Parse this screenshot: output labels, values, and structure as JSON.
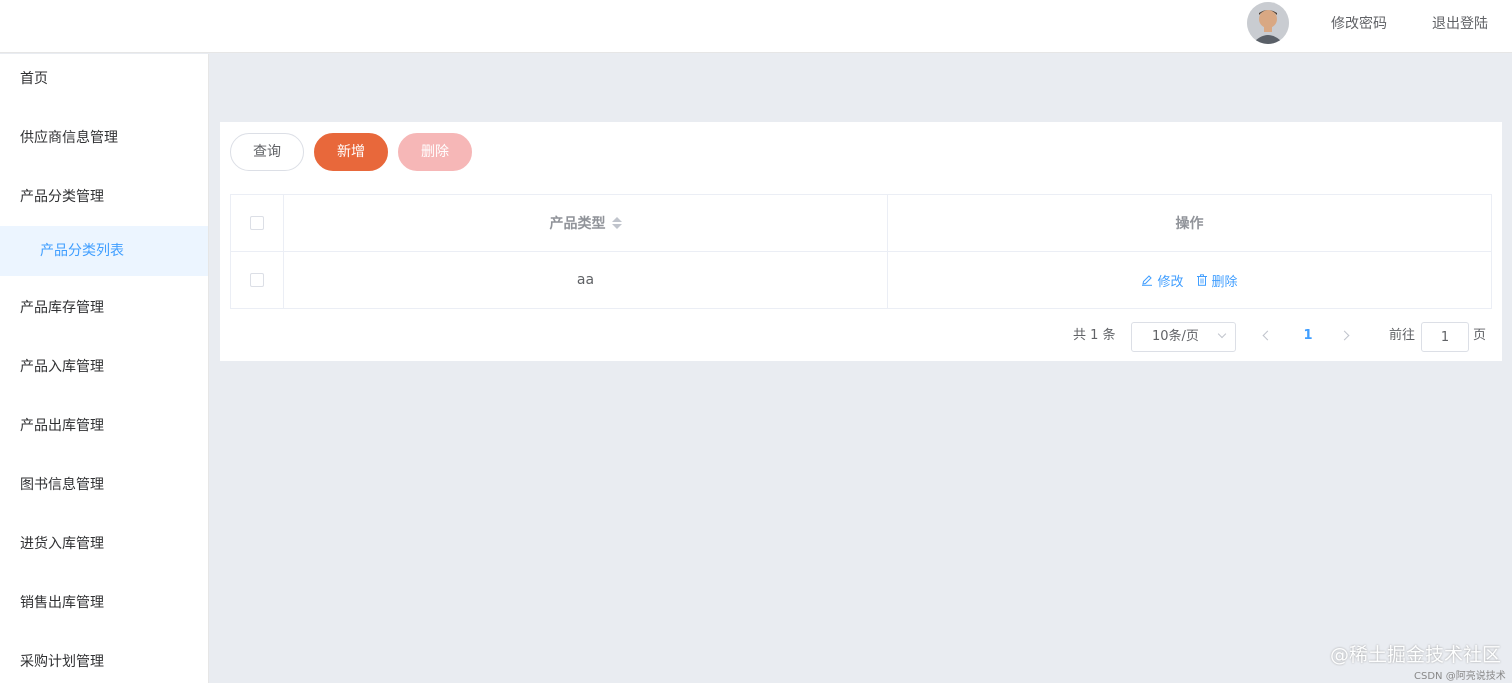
{
  "header": {
    "change_password": "修改密码",
    "logout": "退出登陆"
  },
  "sidebar": {
    "items": [
      {
        "label": "首页"
      },
      {
        "label": "供应商信息管理"
      },
      {
        "label": "产品分类管理"
      },
      {
        "label": "产品分类列表",
        "active": true
      },
      {
        "label": "产品库存管理"
      },
      {
        "label": "产品入库管理"
      },
      {
        "label": "产品出库管理"
      },
      {
        "label": "图书信息管理"
      },
      {
        "label": "进货入库管理"
      },
      {
        "label": "销售出库管理"
      },
      {
        "label": "采购计划管理"
      }
    ]
  },
  "toolbar": {
    "query_label": "查询",
    "add_label": "新增",
    "delete_label": "删除"
  },
  "table": {
    "columns": [
      "产品类型",
      "操作"
    ],
    "rows": [
      {
        "product_type": "aa",
        "edit_label": "修改",
        "delete_label": "删除"
      }
    ]
  },
  "pagination": {
    "total": "共 1 条",
    "page_size": "10条/页",
    "current_page": "1",
    "goto_label": "前往",
    "goto_value": "1",
    "goto_unit": "页"
  },
  "watermark": {
    "main": "@稀土掘金技术社区",
    "sub": "CSDN @阿亮说技术"
  },
  "colors": {
    "primary": "#409eff",
    "add_button": "#e8683b",
    "delete_button_disabled": "#f6b7b7",
    "background": "#e9ecf1"
  }
}
